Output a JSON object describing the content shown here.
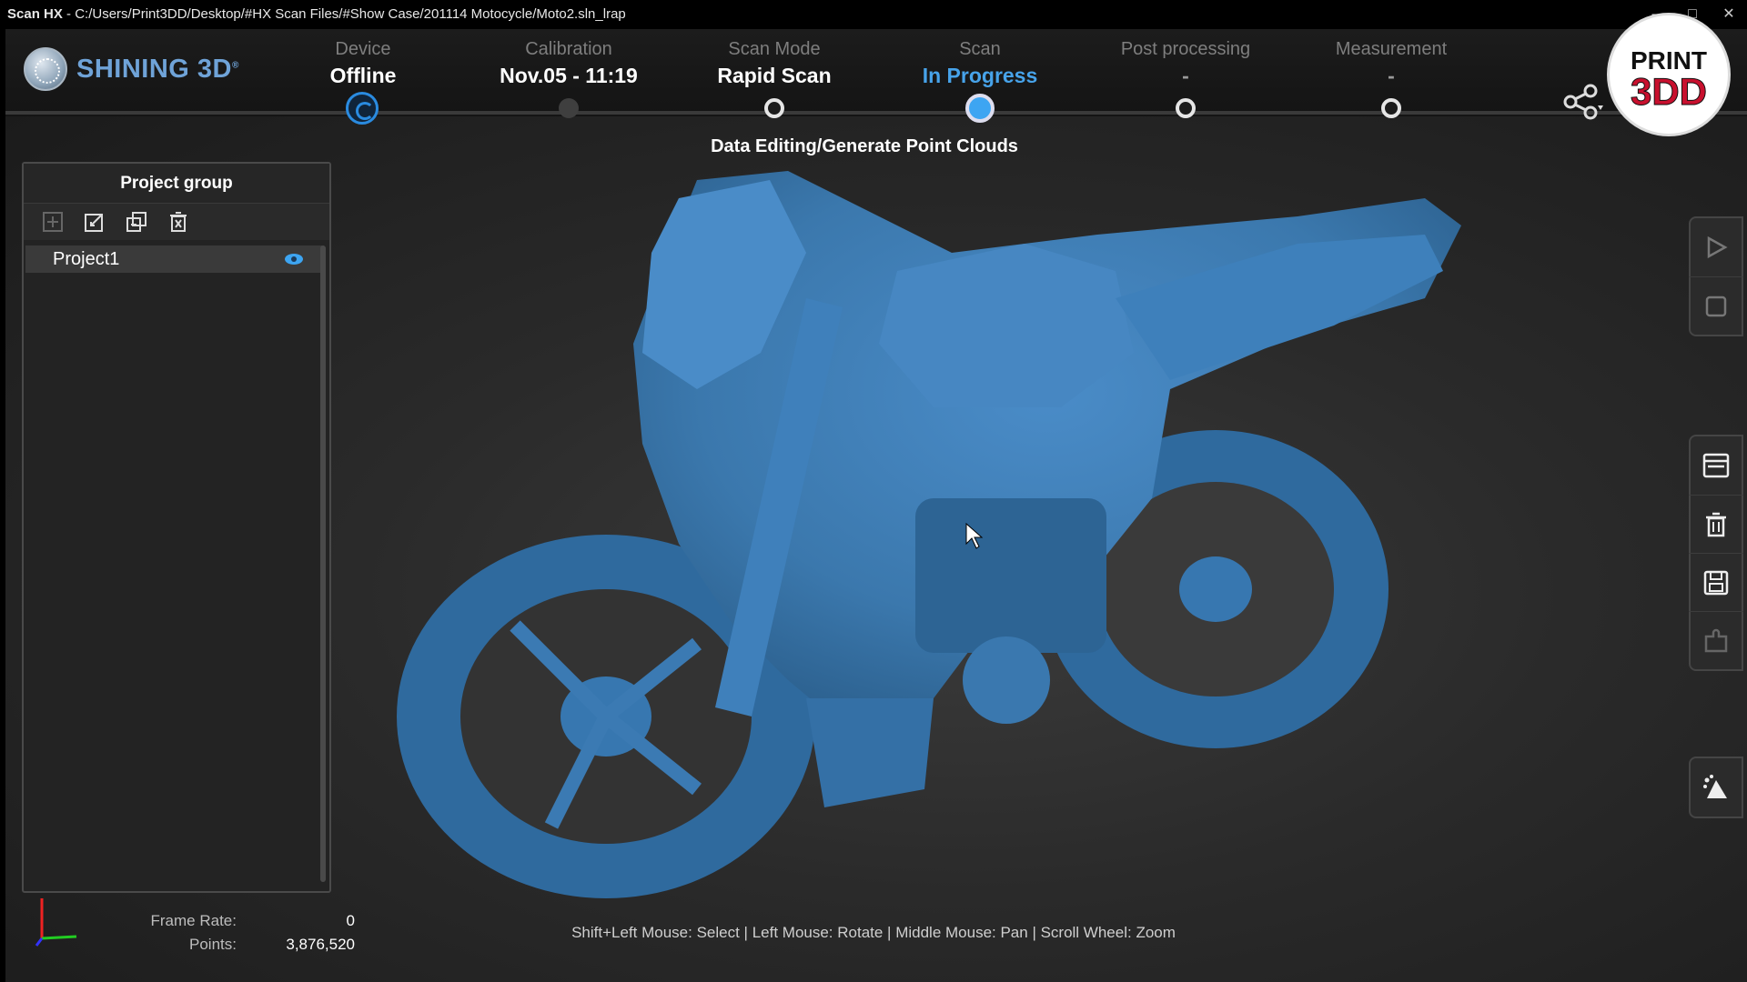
{
  "window": {
    "app_name": "Scan HX",
    "separator": " - ",
    "path": "C:/Users/Print3DD/Desktop/#HX Scan Files/#Show Case/201114 Motocycle/Moto2.sln_lrap"
  },
  "brand": {
    "logo_text": "SHINING 3D",
    "registered": "®"
  },
  "steps": [
    {
      "label": "Device",
      "value": "Offline",
      "state": "sync"
    },
    {
      "label": "Calibration",
      "value": "Nov.05 - 11:19",
      "state": "done"
    },
    {
      "label": "Scan Mode",
      "value": "Rapid Scan",
      "state": "done"
    },
    {
      "label": "Scan",
      "value": "In Progress",
      "state": "current"
    },
    {
      "label": "Post processing",
      "value": "-",
      "state": "pending"
    },
    {
      "label": "Measurement",
      "value": "-",
      "state": "pending"
    }
  ],
  "subtitle": "Data Editing/Generate Point Clouds",
  "badge": {
    "line1": "PRINT",
    "line2": "3DD"
  },
  "panel": {
    "title": "Project group",
    "tools": [
      "add-icon",
      "import-icon",
      "duplicate-icon",
      "delete-icon"
    ],
    "projects": [
      {
        "name": "Project1",
        "visible": true
      }
    ]
  },
  "status": {
    "frame_rate_label": "Frame Rate:",
    "frame_rate": "0",
    "points_label": "Points:",
    "points": "3,876,520"
  },
  "hint": "Shift+Left Mouse: Select | Left Mouse: Rotate | Middle Mouse: Pan | Scroll Wheel: Zoom",
  "right_toolbar": {
    "group1": [
      "play-icon",
      "square-icon"
    ],
    "group2": [
      "window-icon",
      "trash-icon",
      "save-icon",
      "plugin-icon"
    ],
    "group3": [
      "point-cloud-icon"
    ]
  },
  "colors": {
    "accent": "#3da5f2",
    "model": "#3f7fb8",
    "background": "#2a2a2a"
  }
}
